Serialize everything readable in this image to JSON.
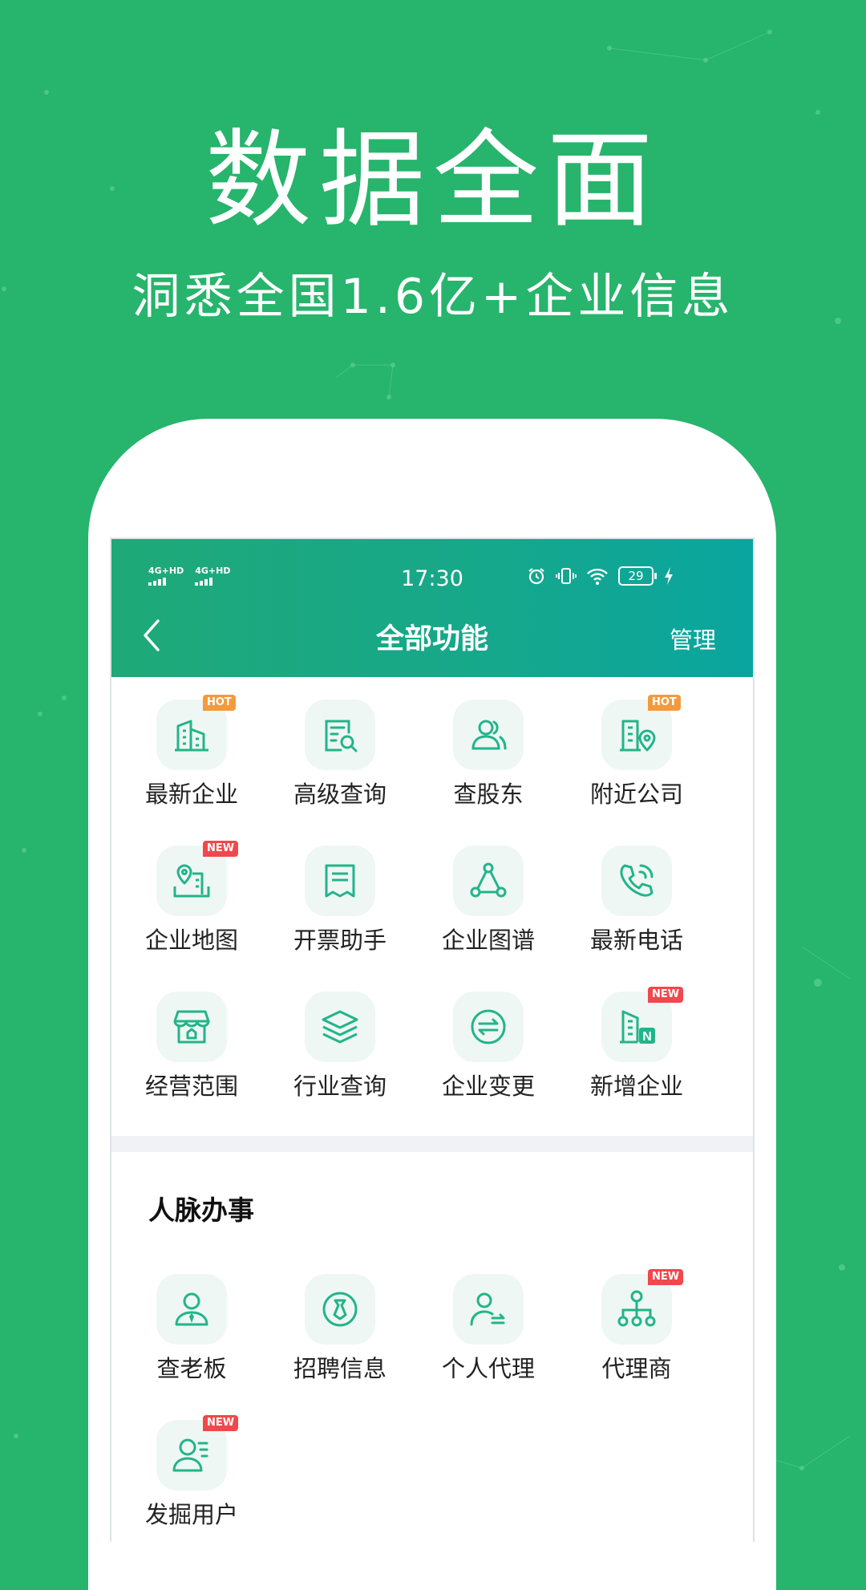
{
  "hero": {
    "title": "数据全面",
    "subtitle": "洞悉全国1.6亿+企业信息"
  },
  "status_bar": {
    "network_1": "4G+HD",
    "network_2": "4G+HD",
    "time": "17:30",
    "battery": "29"
  },
  "nav": {
    "title": "全部功能",
    "manage": "管理"
  },
  "section1": {
    "items": [
      {
        "label": "最新企业",
        "badge": "HOT",
        "icon": "building-icon"
      },
      {
        "label": "高级查询",
        "badge": "",
        "icon": "document-search-icon"
      },
      {
        "label": "查股东",
        "badge": "",
        "icon": "shareholder-icon"
      },
      {
        "label": "附近公司",
        "badge": "HOT",
        "icon": "nearby-building-icon"
      },
      {
        "label": "企业地图",
        "badge": "NEW",
        "icon": "map-pin-icon"
      },
      {
        "label": "开票助手",
        "badge": "",
        "icon": "receipt-icon"
      },
      {
        "label": "企业图谱",
        "badge": "",
        "icon": "graph-icon"
      },
      {
        "label": "最新电话",
        "badge": "",
        "icon": "phone-icon"
      },
      {
        "label": "经营范围",
        "badge": "",
        "icon": "store-icon"
      },
      {
        "label": "行业查询",
        "badge": "",
        "icon": "layers-icon"
      },
      {
        "label": "企业变更",
        "badge": "",
        "icon": "exchange-icon"
      },
      {
        "label": "新增企业",
        "badge": "NEW",
        "icon": "new-building-icon"
      }
    ]
  },
  "section2": {
    "title": "人脉办事",
    "items": [
      {
        "label": "查老板",
        "badge": "",
        "icon": "boss-icon"
      },
      {
        "label": "招聘信息",
        "badge": "",
        "icon": "recruit-icon"
      },
      {
        "label": "个人代理",
        "badge": "",
        "icon": "agent-person-icon"
      },
      {
        "label": "代理商",
        "badge": "NEW",
        "icon": "org-chart-icon"
      },
      {
        "label": "发掘用户",
        "badge": "NEW",
        "icon": "find-user-icon"
      }
    ]
  },
  "colors": {
    "background": "#27b46c",
    "accent": "#22b48a",
    "hot_badge": "#f39a3d",
    "new_badge": "#f0484c"
  }
}
